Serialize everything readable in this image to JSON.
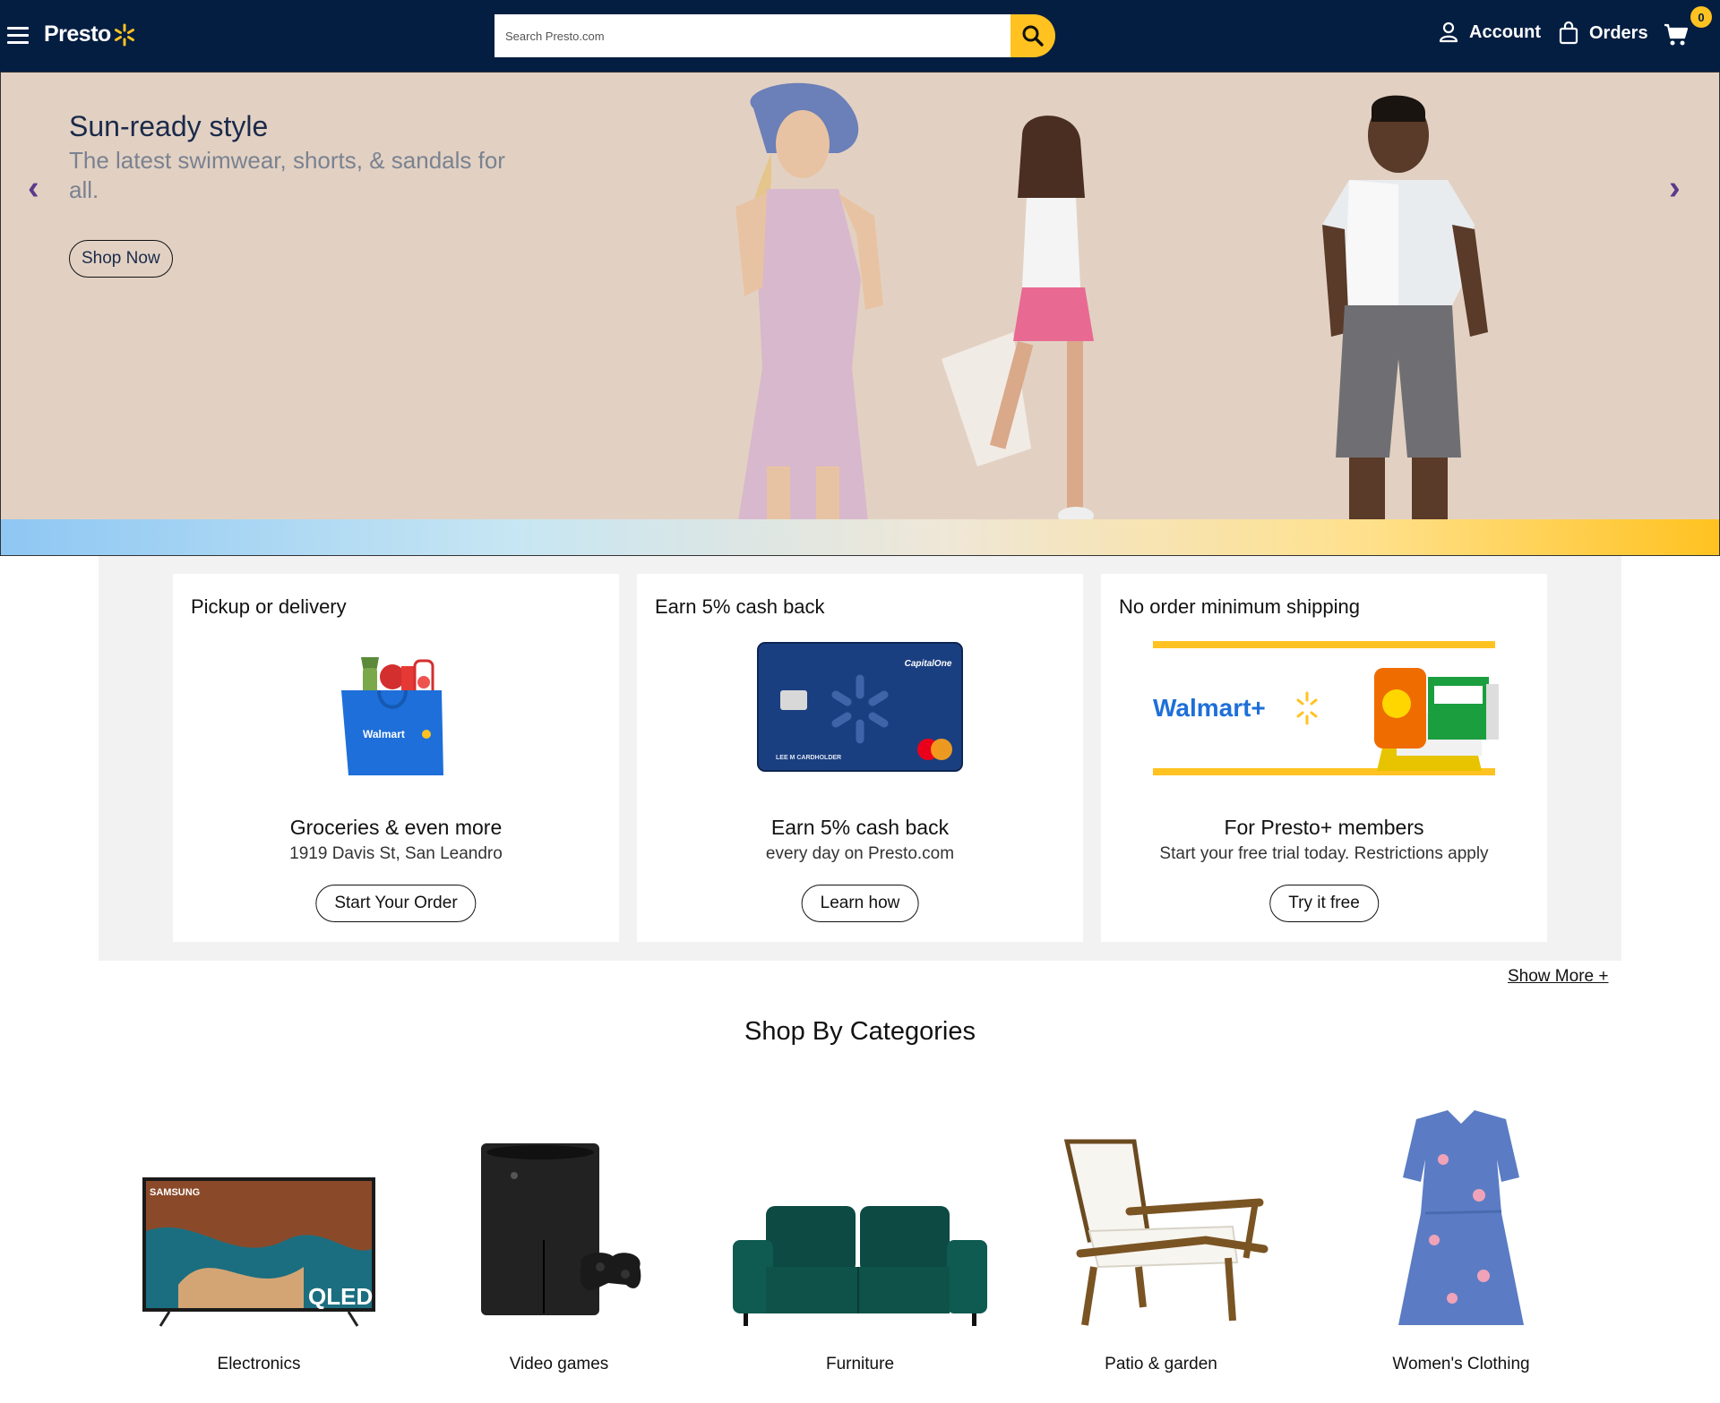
{
  "header": {
    "logo_text": "Presto",
    "search_placeholder": "Search Presto.com",
    "account_label": "Account",
    "orders_label": "Orders",
    "cart_count": "0"
  },
  "hero": {
    "title": "Sun-ready style",
    "subtitle": "The latest swimwear, shorts, & sandals for all.",
    "button_label": "Shop Now",
    "prev_arrow": "‹",
    "next_arrow": "›"
  },
  "promos": [
    {
      "label": "Pickup or delivery",
      "bag_brand": "Walmart",
      "title": "Groceries & even more",
      "text": "1919 Davis St, San Leandro",
      "button": "Start Your Order"
    },
    {
      "label": "Earn 5% cash back",
      "card_brand": "CapitalOne",
      "card_holder": "LEE M CARDHOLDER",
      "title": "Earn 5% cash back",
      "text": "every day on Presto.com",
      "button": "Learn how"
    },
    {
      "label": "No order minimum shipping",
      "brand": "Walmart+",
      "title": "For Presto+ members",
      "text": "Start your free trial today. Restrictions apply",
      "button": "Try it free"
    }
  ],
  "show_more": "Show More +",
  "categories": {
    "heading": "Shop By Categories",
    "items": [
      {
        "label": "Electronics",
        "tv_brand": "SAMSUNG",
        "tv_model": "QLED"
      },
      {
        "label": "Video games"
      },
      {
        "label": "Furniture"
      },
      {
        "label": "Patio & garden"
      },
      {
        "label": "Women's Clothing"
      }
    ]
  },
  "colors": {
    "header_bg": "#041e42",
    "accent": "#ffc220",
    "hero_bg": "#e2d1c3",
    "promo_bg": "#f2f2f2"
  }
}
